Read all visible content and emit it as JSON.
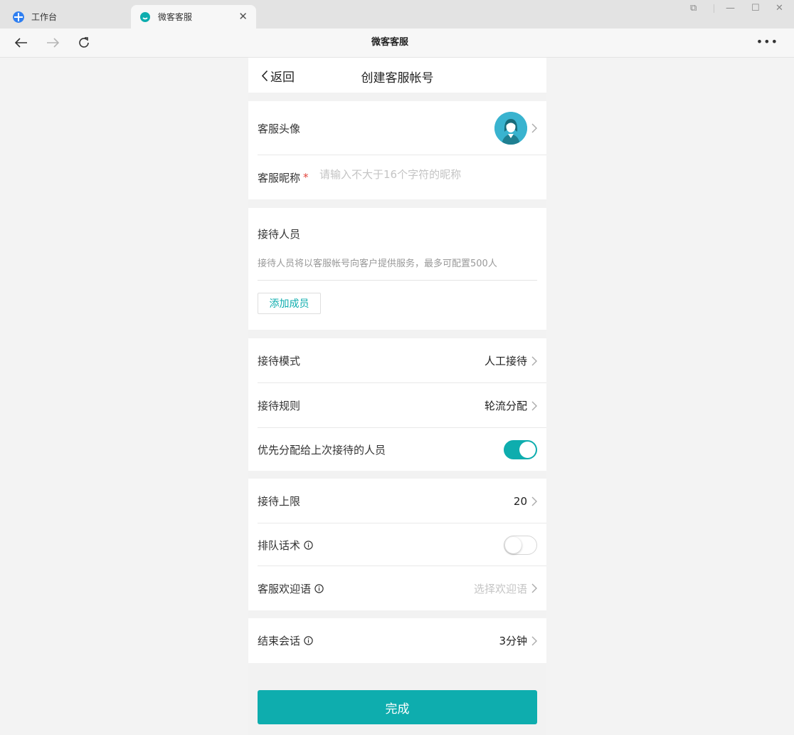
{
  "browser": {
    "tabs": [
      {
        "label": "工作台",
        "icon": "workbench-icon",
        "color": "#2f7ff1"
      },
      {
        "label": "微客客服",
        "icon": "wecom-service-icon",
        "color": "#0eadae"
      }
    ],
    "close_symbol": "✕",
    "window_controls": {
      "restore": "⧉",
      "minimize": "—",
      "maximize": "☐",
      "close": "✕"
    },
    "page_title": "微客客服",
    "more_symbol": "•••"
  },
  "header": {
    "back_label": "返回",
    "title": "创建客服帐号"
  },
  "profile": {
    "avatar_label": "客服头像",
    "nickname_label": "客服昵称",
    "required_mark": "*",
    "nickname_value": "",
    "nickname_placeholder": "请输入不大于16个字符的昵称"
  },
  "staff": {
    "title": "接待人员",
    "desc": "接待人员将以客服帐号向客户提供服务，最多可配置500人",
    "add_button": "添加成员"
  },
  "reception": {
    "mode_label": "接待模式",
    "mode_value": "人工接待",
    "rule_label": "接待规则",
    "rule_value": "轮流分配",
    "priority_label": "优先分配给上次接待的人员",
    "priority_enabled": true
  },
  "limits": {
    "limit_label": "接待上限",
    "limit_value": "20",
    "queue_label": "排队话术",
    "queue_enabled": false,
    "welcome_label": "客服欢迎语",
    "welcome_placeholder": "选择欢迎语"
  },
  "session": {
    "end_label": "结束会话",
    "end_value": "3分钟"
  },
  "done_button": "完成",
  "colors": {
    "accent": "#0eadae",
    "required": "#e2443c",
    "page_bg": "#f2f2f2"
  }
}
